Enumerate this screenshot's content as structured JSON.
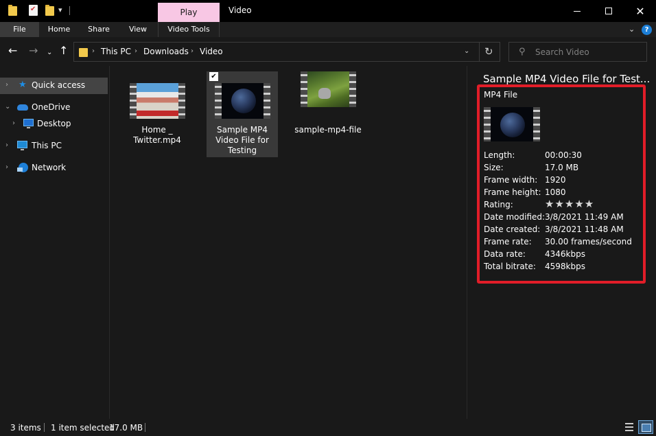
{
  "window": {
    "title": "Video",
    "contextual_tab": "Play"
  },
  "ribbon": {
    "tabs": [
      "File",
      "Home",
      "Share",
      "View",
      "Video Tools"
    ]
  },
  "address": {
    "crumbs": [
      "This PC",
      "Downloads",
      "Video"
    ]
  },
  "search": {
    "placeholder": "Search Video"
  },
  "nav": {
    "items": [
      {
        "label": "Quick access",
        "icon": "star-icon"
      },
      {
        "label": "OneDrive",
        "icon": "cloud-icon"
      },
      {
        "label": "Desktop",
        "icon": "monitor-icon"
      },
      {
        "label": "This PC",
        "icon": "monitor-icon"
      },
      {
        "label": "Network",
        "icon": "network-icon"
      }
    ]
  },
  "files": [
    {
      "name": "Home _ Twitter.mp4",
      "selected": false
    },
    {
      "name": "Sample MP4 Video File for Testing",
      "selected": true
    },
    {
      "name": "sample-mp4-file",
      "selected": false
    }
  ],
  "details": {
    "title": "Sample MP4 Video File for Test...",
    "type": "MP4 File",
    "rating_stars": "★★★★★",
    "properties": [
      {
        "label": "Length:",
        "value": "00:00:30"
      },
      {
        "label": "Size:",
        "value": "17.0 MB"
      },
      {
        "label": "Frame width:",
        "value": "1920"
      },
      {
        "label": "Frame height:",
        "value": "1080"
      },
      {
        "label": "Rating:",
        "value": ""
      },
      {
        "label": "Date modified:",
        "value": "3/8/2021 11:49 AM"
      },
      {
        "label": "Date created:",
        "value": "3/8/2021 11:48 AM"
      },
      {
        "label": "Frame rate:",
        "value": "30.00 frames/second"
      },
      {
        "label": "Data rate:",
        "value": "4346kbps"
      },
      {
        "label": "Total bitrate:",
        "value": "4598kbps"
      }
    ],
    "highlight_color": "#e11d28"
  },
  "status": {
    "item_count": "3 items",
    "selection": "1 item selected",
    "selection_size": "17.0 MB"
  },
  "colors": {
    "accent": "#1d7fd7",
    "background": "#191919",
    "context_tab": "#f8c7e4"
  }
}
